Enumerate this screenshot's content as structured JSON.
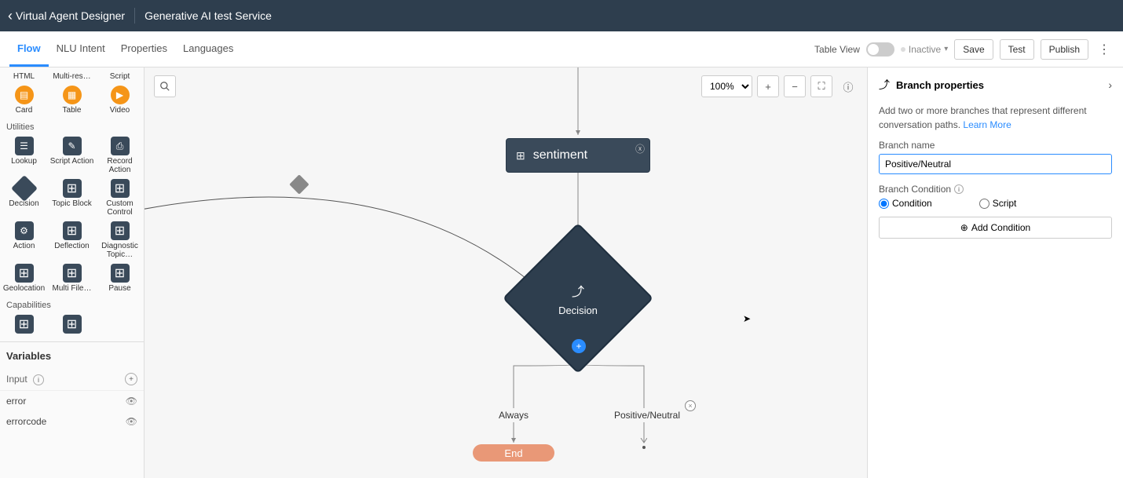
{
  "topbar": {
    "title1": "Virtual Agent Designer",
    "title2": "Generative AI test Service"
  },
  "tabs": [
    "Flow",
    "NLU Intent",
    "Properties",
    "Languages"
  ],
  "activeTab": 0,
  "toolbar": {
    "tableViewLabel": "Table View",
    "tableView": false,
    "status": "Inactive",
    "save": "Save",
    "test": "Test",
    "publish": "Publish"
  },
  "canvas": {
    "zoom": "100%",
    "nodes": {
      "sentiment": "sentiment",
      "decision": "Decision",
      "end": "End"
    },
    "branches": {
      "always": "Always",
      "positive": "Positive/Neutral"
    }
  },
  "palette": {
    "row1": [
      "HTML",
      "Multi-res…",
      "Script"
    ],
    "row2": [
      "Card",
      "Table",
      "Video"
    ],
    "utilitiesLabel": "Utilities",
    "u1": [
      "Lookup",
      "Script Action",
      "Record Action"
    ],
    "u2": [
      "Decision",
      "Topic Block",
      "Custom Control"
    ],
    "u3": [
      "Action",
      "Deflection",
      "Diagnostic Topic…"
    ],
    "u4": [
      "Geolocation",
      "Multi File…",
      "Pause"
    ],
    "capabilitiesLabel": "Capabilities"
  },
  "variables": {
    "header": "Variables",
    "inputLabel": "Input",
    "items": [
      "error",
      "errorcode"
    ]
  },
  "rightPanel": {
    "title": "Branch properties",
    "desc": "Add two or more branches that represent different conversation paths. ",
    "learnMore": "Learn More",
    "branchNameLabel": "Branch name",
    "branchName": "Positive/Neutral",
    "branchConditionLabel": "Branch Condition",
    "radioCondition": "Condition",
    "radioScript": "Script",
    "addCondition": "Add Condition"
  }
}
